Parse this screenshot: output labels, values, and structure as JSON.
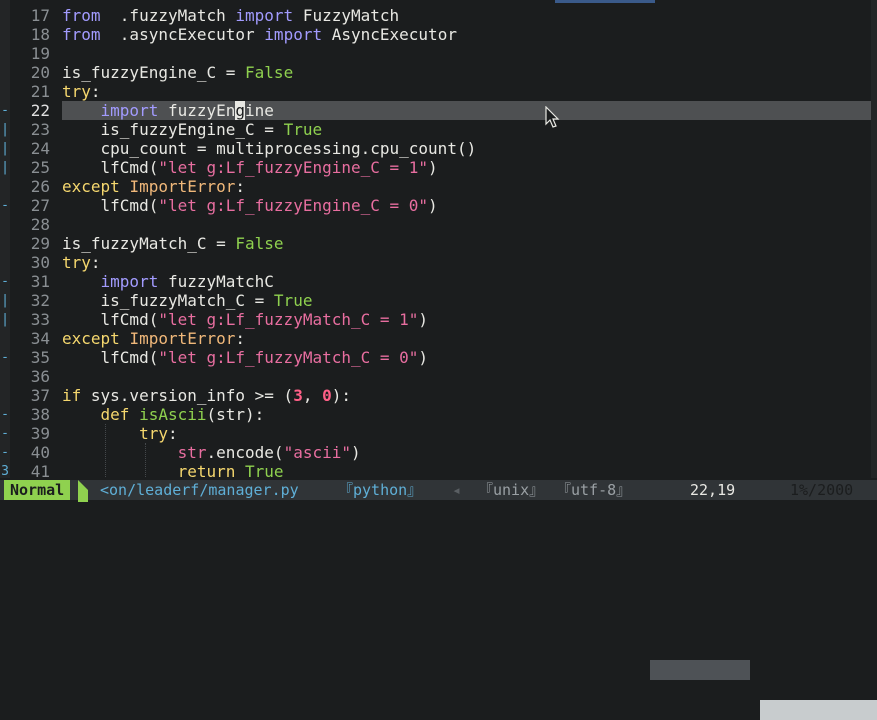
{
  "editor": {
    "lines": [
      {
        "n": "17",
        "fold": "",
        "tokens": [
          [
            "kw2",
            "from"
          ],
          [
            "",
            "  .fuzzyMatch "
          ],
          [
            "kw2",
            "import"
          ],
          [
            "",
            " FuzzyMatch"
          ]
        ]
      },
      {
        "n": "18",
        "fold": "",
        "tokens": [
          [
            "kw2",
            "from"
          ],
          [
            "",
            "  .asyncExecutor "
          ],
          [
            "kw2",
            "import"
          ],
          [
            "",
            " AsyncExecutor"
          ]
        ]
      },
      {
        "n": "19",
        "fold": "",
        "tokens": []
      },
      {
        "n": "20",
        "fold": "",
        "tokens": [
          [
            "",
            "is_fuzzyEngine_C = "
          ],
          [
            "const",
            "False"
          ]
        ]
      },
      {
        "n": "21",
        "fold": "",
        "tokens": [
          [
            "kw",
            "try"
          ],
          [
            "",
            ":"
          ]
        ]
      },
      {
        "n": "22",
        "fold": "-",
        "current": true,
        "tokens": [
          [
            "",
            "    "
          ],
          [
            "kw2",
            "import"
          ],
          [
            "",
            " fuzzyEn"
          ],
          [
            "cursor-char",
            "g"
          ],
          [
            "",
            "ine"
          ]
        ]
      },
      {
        "n": "23",
        "fold": "|",
        "tokens": [
          [
            "",
            "    is_fuzzyEngine_C = "
          ],
          [
            "const",
            "True"
          ]
        ]
      },
      {
        "n": "24",
        "fold": "|",
        "tokens": [
          [
            "",
            "    cpu_count = multiprocessing.cpu_count()"
          ]
        ]
      },
      {
        "n": "25",
        "fold": "|",
        "tokens": [
          [
            "",
            "    lfCmd("
          ],
          [
            "str",
            "\"let g:Lf_fuzzyEngine_C = 1\""
          ],
          [
            "",
            ")"
          ]
        ]
      },
      {
        "n": "26",
        "fold": "",
        "tokens": [
          [
            "kw",
            "except"
          ],
          [
            "",
            " "
          ],
          [
            "exc",
            "ImportError"
          ],
          [
            "",
            ":"
          ]
        ]
      },
      {
        "n": "27",
        "fold": "-",
        "tokens": [
          [
            "",
            "    lfCmd("
          ],
          [
            "str",
            "\"let g:Lf_fuzzyEngine_C = 0\""
          ],
          [
            "",
            ")"
          ]
        ]
      },
      {
        "n": "28",
        "fold": "",
        "tokens": []
      },
      {
        "n": "29",
        "fold": "",
        "tokens": [
          [
            "",
            "is_fuzzyMatch_C = "
          ],
          [
            "const",
            "False"
          ]
        ]
      },
      {
        "n": "30",
        "fold": "",
        "tokens": [
          [
            "kw",
            "try"
          ],
          [
            "",
            ":"
          ]
        ]
      },
      {
        "n": "31",
        "fold": "-",
        "tokens": [
          [
            "",
            "    "
          ],
          [
            "kw2",
            "import"
          ],
          [
            "",
            " fuzzyMatchC"
          ]
        ]
      },
      {
        "n": "32",
        "fold": "|",
        "tokens": [
          [
            "",
            "    is_fuzzyMatch_C = "
          ],
          [
            "const",
            "True"
          ]
        ]
      },
      {
        "n": "33",
        "fold": "|",
        "tokens": [
          [
            "",
            "    lfCmd("
          ],
          [
            "str",
            "\"let g:Lf_fuzzyMatch_C = 1\""
          ],
          [
            "",
            ")"
          ]
        ]
      },
      {
        "n": "34",
        "fold": "",
        "tokens": [
          [
            "kw",
            "except"
          ],
          [
            "",
            " "
          ],
          [
            "exc",
            "ImportError"
          ],
          [
            "",
            ":"
          ]
        ]
      },
      {
        "n": "35",
        "fold": "-",
        "tokens": [
          [
            "",
            "    lfCmd("
          ],
          [
            "str",
            "\"let g:Lf_fuzzyMatch_C = 0\""
          ],
          [
            "",
            ")"
          ]
        ]
      },
      {
        "n": "36",
        "fold": "",
        "tokens": []
      },
      {
        "n": "37",
        "fold": "",
        "tokens": [
          [
            "kw",
            "if"
          ],
          [
            "",
            " sys.version_info >= ("
          ],
          [
            "num",
            "3"
          ],
          [
            "",
            ", "
          ],
          [
            "num",
            "0"
          ],
          [
            "",
            "):"
          ]
        ]
      },
      {
        "n": "38",
        "fold": "-",
        "tokens": [
          [
            "",
            "    "
          ],
          [
            "kw",
            "def"
          ],
          [
            "",
            " "
          ],
          [
            "func",
            "isAscii"
          ],
          [
            "",
            "(str):"
          ]
        ]
      },
      {
        "n": "39",
        "fold": "-",
        "tokens": [
          [
            "",
            "        "
          ],
          [
            "kw",
            "try"
          ],
          [
            "",
            ":"
          ]
        ]
      },
      {
        "n": "40",
        "fold": "-",
        "tokens": [
          [
            "",
            "            "
          ],
          [
            "str",
            "str"
          ],
          [
            "",
            ".encode("
          ],
          [
            "str",
            "\"ascii\""
          ],
          [
            "",
            ")"
          ]
        ]
      },
      {
        "n": "41",
        "fold": "3",
        "tokens": [
          [
            "",
            "            "
          ],
          [
            "kw",
            "return"
          ],
          [
            "",
            " "
          ],
          [
            "const",
            "True"
          ]
        ]
      }
    ]
  },
  "statusline": {
    "mode": "Normal",
    "file": "<on/leaderf/manager.py",
    "filetype": "『python』",
    "separator": "◂",
    "fileformat": "『unix』",
    "encoding": "『utf-8』",
    "position": "22,19",
    "percent": "1%/2000"
  },
  "colors": {
    "background": "#1b1d1e",
    "keyword": "#f5d76e",
    "import_keyword": "#a29bfe",
    "string": "#e86ea0",
    "constant": "#8fd14f",
    "mode_bg": "#8fd14f"
  }
}
